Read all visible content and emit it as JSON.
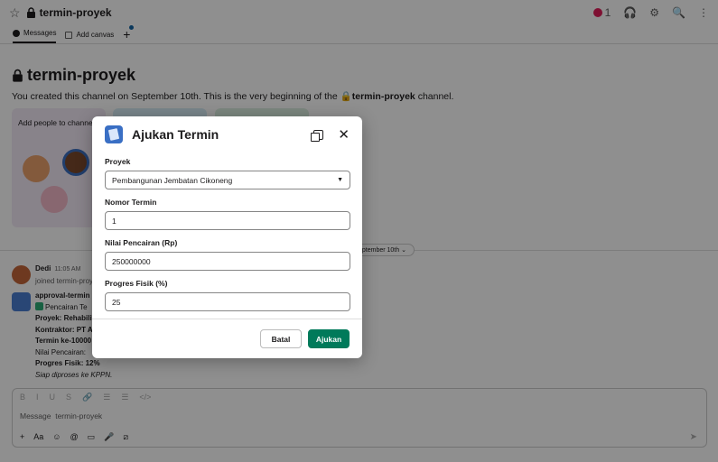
{
  "channel": {
    "name": "termin-proyek",
    "member_count": "1",
    "intro_prefix": "You created this channel on September 10th. This is the very beginning of the",
    "intro_suffix": "channel."
  },
  "tabs": [
    {
      "label": "Messages"
    },
    {
      "label": "Add canvas"
    }
  ],
  "cards": {
    "add_people": "Add people to channel"
  },
  "date_divider": "eptember 10th",
  "messages": [
    {
      "name": "Dedi",
      "time": "11:05 AM",
      "text": "joined termin-proyek"
    },
    {
      "name": "approval-termin",
      "lines": [
        "Pencairan Te",
        "Proyek: Rehabilit",
        "Kontraktor: PT A",
        "Termin ke-10000",
        "Nilai Pencairan:",
        "Progres Fisik: 12%",
        "Siap diproses ke KPPN."
      ]
    }
  ],
  "composer": {
    "placeholder": "Message  termin-proyek"
  },
  "modal": {
    "title": "Ajukan Termin",
    "fields": {
      "proyek": {
        "label": "Proyek",
        "value": "Pembangunan Jembatan Cikoneng"
      },
      "nomor": {
        "label": "Nomor Termin",
        "value": "1"
      },
      "nilai": {
        "label": "Nilai Pencairan (Rp)",
        "value": "250000000"
      },
      "progres": {
        "label": "Progres Fisik (%)",
        "value": "25"
      }
    },
    "cancel_label": "Batal",
    "submit_label": "Ajukan"
  },
  "colors": {
    "primary_button": "#007a5a",
    "overlay": "rgba(0,0,0,0.44)"
  },
  "icons": [
    "star-icon",
    "lock-icon",
    "headphones-icon",
    "settings-icon",
    "search-icon",
    "more-icon",
    "popout-icon",
    "close-icon",
    "chevron-down-icon"
  ]
}
